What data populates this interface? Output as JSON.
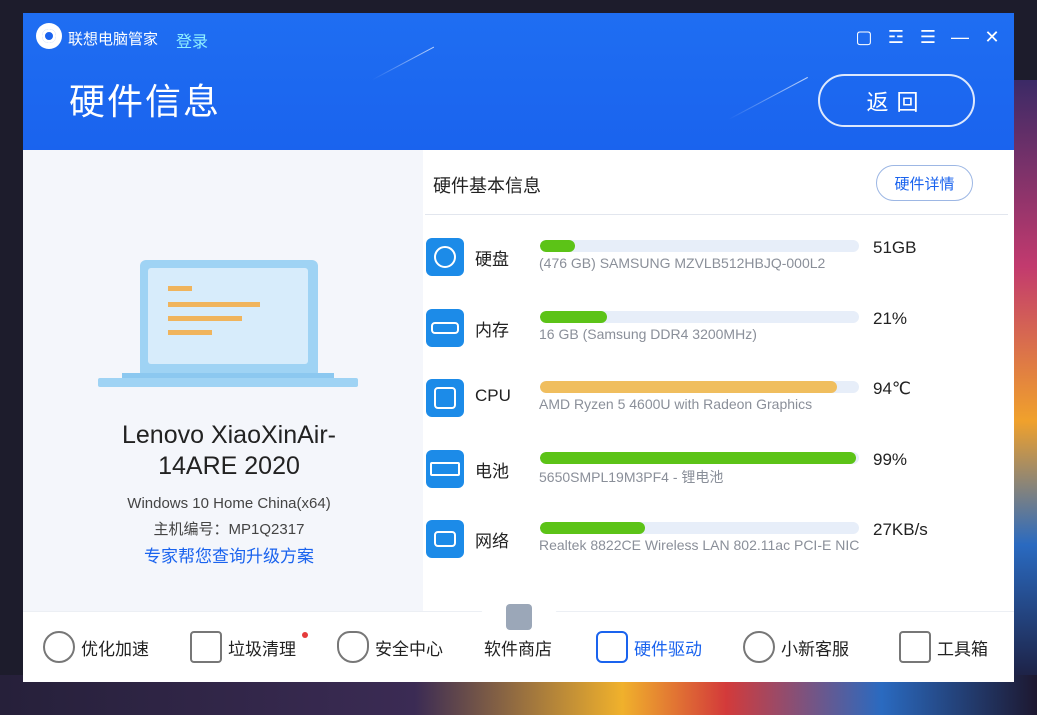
{
  "app": {
    "name": "联想电脑管家",
    "login_label": "登录"
  },
  "header": {
    "title": "硬件信息",
    "back_label": "返回"
  },
  "window_controls": [
    "feedback-icon",
    "skin-icon",
    "menu-icon",
    "minimize-icon",
    "close-icon"
  ],
  "device": {
    "model_line1": "Lenovo XiaoXinAir-",
    "model_line2": "14ARE 2020",
    "os": "Windows 10 Home China(x64)",
    "serial_label": "主机编号：MP1Q2317",
    "upgrade_link": "专家帮您查询升级方案"
  },
  "hardware": {
    "section_title": "硬件基本信息",
    "detail_button": "硬件详情",
    "items": [
      {
        "name": "硬盘",
        "desc": "(476 GB) SAMSUNG MZVLB512HBJQ-000L2",
        "value": "51GB",
        "level": 0.11,
        "color": "#5cc317",
        "icon": "hard-disk-icon"
      },
      {
        "name": "内存",
        "desc": "16 GB (Samsung DDR4 3200MHz)",
        "value": "21%",
        "level": 0.21,
        "color": "#5cc317",
        "icon": "memory-icon"
      },
      {
        "name": "CPU",
        "desc": "AMD Ryzen 5 4600U with Radeon Graphics",
        "value": "94℃",
        "level": 0.93,
        "color": "#f0be5e",
        "icon": "cpu-icon"
      },
      {
        "name": "电池",
        "desc": "5650SMPL19M3PF4 - 锂电池",
        "value": "99%",
        "level": 0.99,
        "color": "#5cc317",
        "icon": "battery-icon"
      },
      {
        "name": "网络",
        "desc": "Realtek 8822CE Wireless LAN 802.11ac PCI-E NIC",
        "value": "27KB/s",
        "level": 0.33,
        "color": "#5cc317",
        "icon": "network-icon"
      }
    ]
  },
  "nav": {
    "items": [
      {
        "label": "优化加速",
        "icon": "speedometer-icon"
      },
      {
        "label": "垃圾清理",
        "icon": "trash-icon"
      },
      {
        "label": "安全中心",
        "icon": "shield-icon"
      },
      {
        "label": "软件商店",
        "icon": "store-bag-icon"
      },
      {
        "label": "硬件驱动",
        "icon": "hardware-driver-icon",
        "active": true
      },
      {
        "label": "小新客服",
        "icon": "headset-icon"
      },
      {
        "label": "工具箱",
        "icon": "toolbox-icon"
      }
    ]
  },
  "colors": {
    "header_blue": "#1a63ee",
    "bar_green": "#5cc317",
    "bar_orange": "#f0be5e"
  }
}
